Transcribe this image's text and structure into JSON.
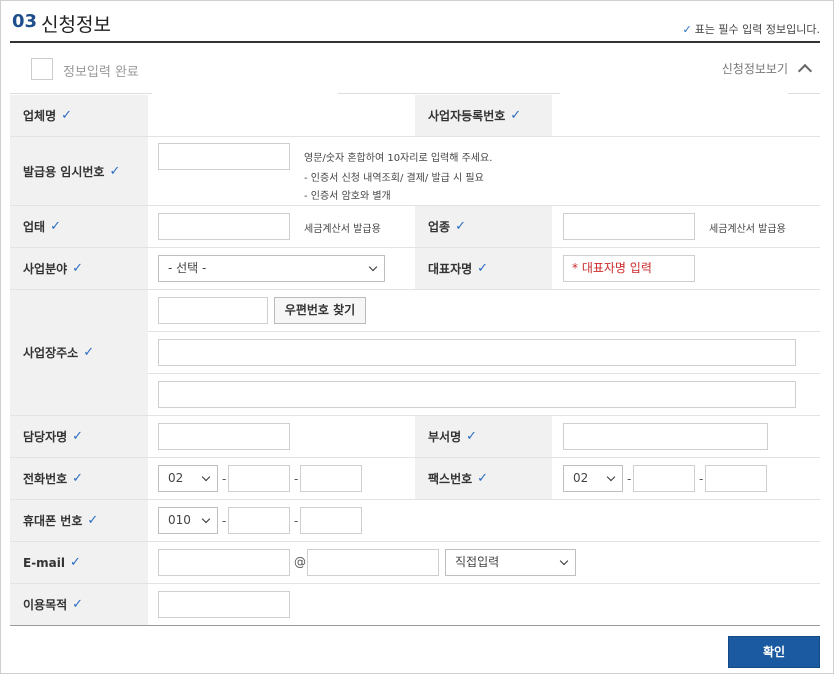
{
  "section": {
    "number": "03",
    "title": "신청정보",
    "required_note": "표는 필수 입력 정보입니다."
  },
  "complete": {
    "label": "정보입력 완료",
    "view_toggle": "신청정보보기"
  },
  "fields": {
    "company_name": "업체명",
    "biz_reg_no": "사업자등록번호",
    "temp_no": "발급용 임시번호",
    "temp_help": [
      "영문/숫자 혼합하여 10자리로 입력해 주세요.",
      "- 인증서 신청 내역조회/ 결제/ 발급 시 필요",
      "- 인증서 암호와 별개"
    ],
    "biz_type": "업태",
    "biz_type_help": "세금계산서 발급용",
    "biz_item": "업종",
    "biz_item_help": "세금계산서 발급용",
    "biz_field": "사업분야",
    "biz_field_select": "- 선택 -",
    "ceo_name": "대표자명",
    "ceo_placeholder": "* 대표자명 입력",
    "address": "사업장주소",
    "zip_button": "우편번호 찾기",
    "manager": "담당자명",
    "department": "부서명",
    "phone": "전화번호",
    "phone_area": "02",
    "fax": "팩스번호",
    "fax_area": "02",
    "mobile": "휴대폰 번호",
    "mobile_prefix": "010",
    "email": "E-mail",
    "email_at": "@",
    "email_domain_select": "직접입력",
    "purpose": "이용목적"
  },
  "dash": "-",
  "confirm_label": "확인"
}
